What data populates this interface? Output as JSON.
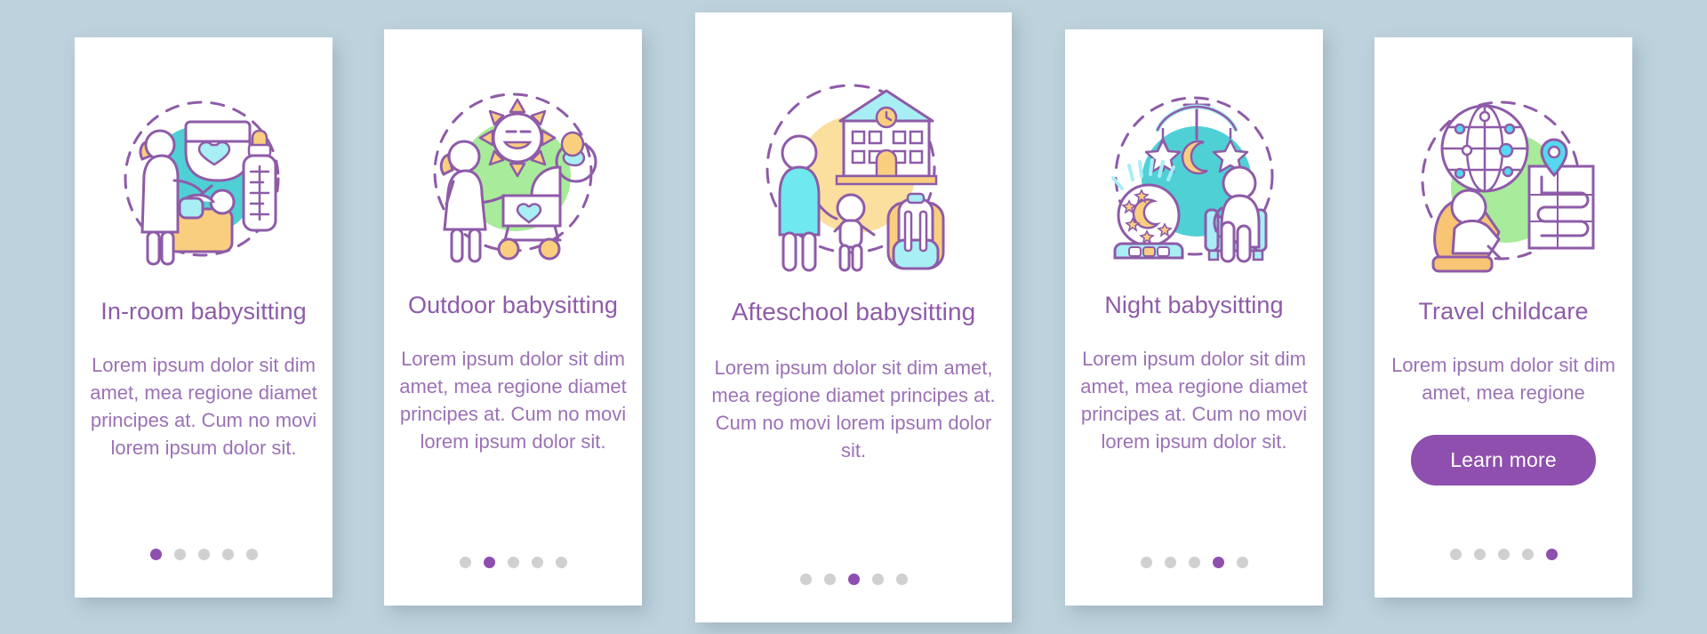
{
  "theme": {
    "background": "#bdd2dc",
    "card_background": "#ffffff",
    "title_color": "#8e5ba8",
    "body_color": "#9b72b5",
    "accent_color": "#8e4fae",
    "dot_inactive_color": "#d0d0d0",
    "illustration_outline": "#8e5ba8",
    "teal": "#4fd0d5",
    "green": "#a8eb9a",
    "yellow": "#f9cf7f",
    "light_blue": "#a8eef5",
    "white": "#ffffff"
  },
  "cards": [
    {
      "id": "in-room-babysitting",
      "title": "In-room babysitting",
      "title_lines": [
        "In-room",
        "babysitting"
      ],
      "body": "Lorem ipsum dolor sit dim amet, mea regione diamet principes at. Cum no movi lorem ipsum dolor sit.",
      "illustration": "woman-changing-baby-diaper-bottle",
      "accent_circle": "teal",
      "dots": {
        "count": 5,
        "active": 1
      },
      "button": null
    },
    {
      "id": "outdoor-babysitting",
      "title": "Outdoor babysitting",
      "title_lines": [
        "Outdoor",
        "babysitting"
      ],
      "body": "Lorem ipsum dolor sit dim amet, mea regione diamet principes at. Cum no movi lorem ipsum dolor sit.",
      "illustration": "woman-stroller-sun-pacifier",
      "accent_circle": "green",
      "dots": {
        "count": 5,
        "active": 2
      },
      "button": null
    },
    {
      "id": "afteschool-babysitting",
      "title": "Afteschool babysitting",
      "title_lines": [
        "Afteschool",
        "babysitting"
      ],
      "body": "Lorem ipsum dolor sit dim amet, mea regione diamet principes at. Cum no movi lorem ipsum dolor sit.",
      "illustration": "school-building-woman-child-backpack",
      "accent_circle": "yellow",
      "dots": {
        "count": 5,
        "active": 3
      },
      "button": null
    },
    {
      "id": "night-babysitting",
      "title": "Night babysitting",
      "title_lines": [
        "Night babysitting"
      ],
      "body": "Lorem ipsum dolor sit dim amet, mea regione diamet principes at. Cum no movi lorem ipsum dolor sit.",
      "illustration": "night-light-mobile-stars-moon-armchair",
      "accent_circle": "teal",
      "dots": {
        "count": 5,
        "active": 4
      },
      "button": null
    },
    {
      "id": "travel-childcare",
      "title": "Travel childcare",
      "title_lines": [
        "Travel childcare"
      ],
      "body": "Lorem ipsum dolor sit dim amet, mea regione",
      "illustration": "globe-carseat-baby-map-pin",
      "accent_circle": "green",
      "dots": {
        "count": 5,
        "active": 5
      },
      "button": "Learn more"
    }
  ]
}
